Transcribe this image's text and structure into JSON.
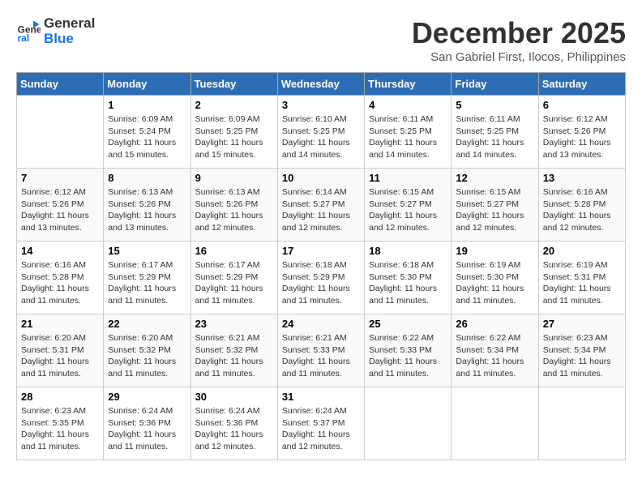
{
  "logo": {
    "line1": "General",
    "line2": "Blue"
  },
  "title": "December 2025",
  "subtitle": "San Gabriel First, Ilocos, Philippines",
  "days_header": [
    "Sunday",
    "Monday",
    "Tuesday",
    "Wednesday",
    "Thursday",
    "Friday",
    "Saturday"
  ],
  "weeks": [
    [
      {
        "day": "",
        "sunrise": "",
        "sunset": "",
        "daylight": ""
      },
      {
        "day": "1",
        "sunrise": "6:09 AM",
        "sunset": "5:24 PM",
        "daylight": "11 hours and 15 minutes."
      },
      {
        "day": "2",
        "sunrise": "6:09 AM",
        "sunset": "5:25 PM",
        "daylight": "11 hours and 15 minutes."
      },
      {
        "day": "3",
        "sunrise": "6:10 AM",
        "sunset": "5:25 PM",
        "daylight": "11 hours and 14 minutes."
      },
      {
        "day": "4",
        "sunrise": "6:11 AM",
        "sunset": "5:25 PM",
        "daylight": "11 hours and 14 minutes."
      },
      {
        "day": "5",
        "sunrise": "6:11 AM",
        "sunset": "5:25 PM",
        "daylight": "11 hours and 14 minutes."
      },
      {
        "day": "6",
        "sunrise": "6:12 AM",
        "sunset": "5:26 PM",
        "daylight": "11 hours and 13 minutes."
      }
    ],
    [
      {
        "day": "7",
        "sunrise": "6:12 AM",
        "sunset": "5:26 PM",
        "daylight": "11 hours and 13 minutes."
      },
      {
        "day": "8",
        "sunrise": "6:13 AM",
        "sunset": "5:26 PM",
        "daylight": "11 hours and 13 minutes."
      },
      {
        "day": "9",
        "sunrise": "6:13 AM",
        "sunset": "5:26 PM",
        "daylight": "11 hours and 12 minutes."
      },
      {
        "day": "10",
        "sunrise": "6:14 AM",
        "sunset": "5:27 PM",
        "daylight": "11 hours and 12 minutes."
      },
      {
        "day": "11",
        "sunrise": "6:15 AM",
        "sunset": "5:27 PM",
        "daylight": "11 hours and 12 minutes."
      },
      {
        "day": "12",
        "sunrise": "6:15 AM",
        "sunset": "5:27 PM",
        "daylight": "11 hours and 12 minutes."
      },
      {
        "day": "13",
        "sunrise": "6:16 AM",
        "sunset": "5:28 PM",
        "daylight": "11 hours and 12 minutes."
      }
    ],
    [
      {
        "day": "14",
        "sunrise": "6:16 AM",
        "sunset": "5:28 PM",
        "daylight": "11 hours and 11 minutes."
      },
      {
        "day": "15",
        "sunrise": "6:17 AM",
        "sunset": "5:29 PM",
        "daylight": "11 hours and 11 minutes."
      },
      {
        "day": "16",
        "sunrise": "6:17 AM",
        "sunset": "5:29 PM",
        "daylight": "11 hours and 11 minutes."
      },
      {
        "day": "17",
        "sunrise": "6:18 AM",
        "sunset": "5:29 PM",
        "daylight": "11 hours and 11 minutes."
      },
      {
        "day": "18",
        "sunrise": "6:18 AM",
        "sunset": "5:30 PM",
        "daylight": "11 hours and 11 minutes."
      },
      {
        "day": "19",
        "sunrise": "6:19 AM",
        "sunset": "5:30 PM",
        "daylight": "11 hours and 11 minutes."
      },
      {
        "day": "20",
        "sunrise": "6:19 AM",
        "sunset": "5:31 PM",
        "daylight": "11 hours and 11 minutes."
      }
    ],
    [
      {
        "day": "21",
        "sunrise": "6:20 AM",
        "sunset": "5:31 PM",
        "daylight": "11 hours and 11 minutes."
      },
      {
        "day": "22",
        "sunrise": "6:20 AM",
        "sunset": "5:32 PM",
        "daylight": "11 hours and 11 minutes."
      },
      {
        "day": "23",
        "sunrise": "6:21 AM",
        "sunset": "5:32 PM",
        "daylight": "11 hours and 11 minutes."
      },
      {
        "day": "24",
        "sunrise": "6:21 AM",
        "sunset": "5:33 PM",
        "daylight": "11 hours and 11 minutes."
      },
      {
        "day": "25",
        "sunrise": "6:22 AM",
        "sunset": "5:33 PM",
        "daylight": "11 hours and 11 minutes."
      },
      {
        "day": "26",
        "sunrise": "6:22 AM",
        "sunset": "5:34 PM",
        "daylight": "11 hours and 11 minutes."
      },
      {
        "day": "27",
        "sunrise": "6:23 AM",
        "sunset": "5:34 PM",
        "daylight": "11 hours and 11 minutes."
      }
    ],
    [
      {
        "day": "28",
        "sunrise": "6:23 AM",
        "sunset": "5:35 PM",
        "daylight": "11 hours and 11 minutes."
      },
      {
        "day": "29",
        "sunrise": "6:24 AM",
        "sunset": "5:36 PM",
        "daylight": "11 hours and 11 minutes."
      },
      {
        "day": "30",
        "sunrise": "6:24 AM",
        "sunset": "5:36 PM",
        "daylight": "11 hours and 12 minutes."
      },
      {
        "day": "31",
        "sunrise": "6:24 AM",
        "sunset": "5:37 PM",
        "daylight": "11 hours and 12 minutes."
      },
      {
        "day": "",
        "sunrise": "",
        "sunset": "",
        "daylight": ""
      },
      {
        "day": "",
        "sunrise": "",
        "sunset": "",
        "daylight": ""
      },
      {
        "day": "",
        "sunrise": "",
        "sunset": "",
        "daylight": ""
      }
    ]
  ],
  "labels": {
    "sunrise_prefix": "Sunrise: ",
    "sunset_prefix": "Sunset: ",
    "daylight_prefix": "Daylight: "
  }
}
